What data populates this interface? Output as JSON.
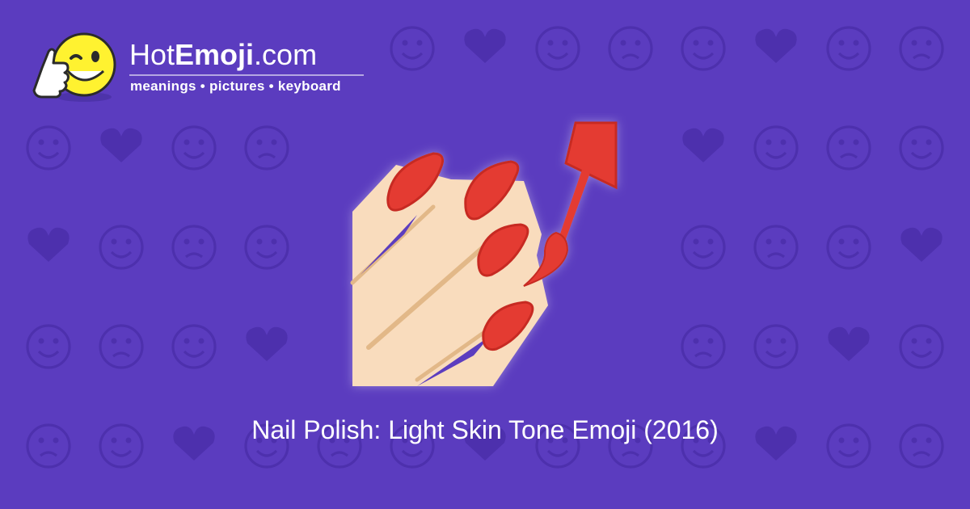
{
  "brand": {
    "name_prefix": "Hot",
    "name_emphasis": "Emoji",
    "name_suffix": ".com",
    "tagline": "meanings • pictures • keyboard",
    "mascot_icon": "winking-thumbs-up-face-icon"
  },
  "caption": "Nail Polish: Light Skin Tone Emoji (2016)",
  "featured_emoji": {
    "icon": "nail-polish-light-skin-tone-icon"
  },
  "colors": {
    "background": "#5b3cbf",
    "pattern": "#4d30ad",
    "nail_red": "#e43a32",
    "skin_light": "#f9dcbd",
    "skin_line": "#e2b888",
    "text": "#ffffff"
  }
}
